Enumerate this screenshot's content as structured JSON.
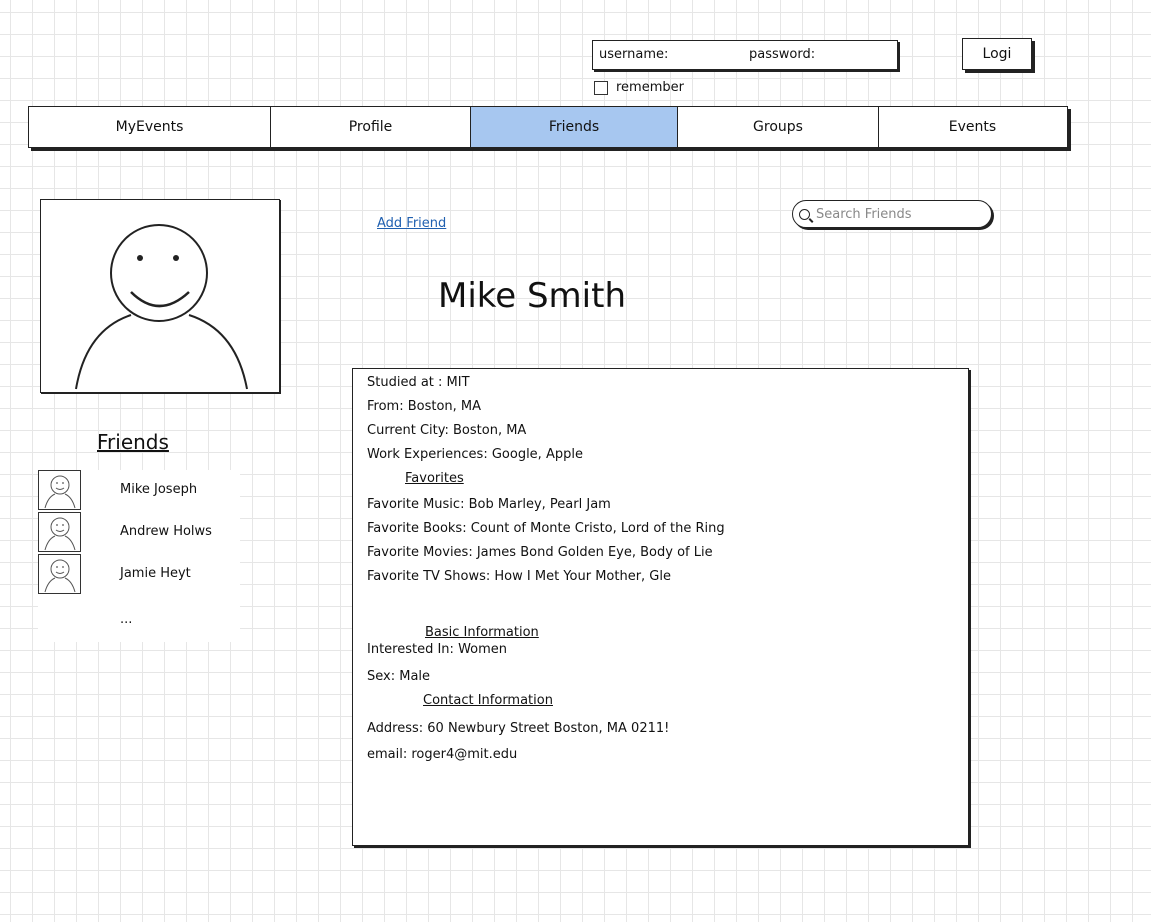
{
  "login": {
    "username_label": "username:",
    "password_label": "password:",
    "remember_label": "remember",
    "login_button": "Logi"
  },
  "nav": {
    "tabs": [
      {
        "label": "MyEvents"
      },
      {
        "label": "Profile"
      },
      {
        "label": "Friends",
        "active": true
      },
      {
        "label": "Groups"
      },
      {
        "label": "Events"
      }
    ],
    "active_color": "#a7c7f0"
  },
  "actions": {
    "add_friend": "Add Friend",
    "search_placeholder": "Search Friends"
  },
  "profile": {
    "name": "Mike Smith"
  },
  "friends": {
    "title": "Friends",
    "items": [
      {
        "name": "Mike Joseph"
      },
      {
        "name": "Andrew Holws"
      },
      {
        "name": "Jamie Heyt"
      }
    ],
    "more": "..."
  },
  "info": {
    "studied": "Studied at : MIT",
    "from": "From: Boston, MA",
    "current_city": "Current City: Boston, MA",
    "work": "Work Experiences: Google, Apple",
    "favorites_heading": "Favorites",
    "music": "Favorite Music: Bob Marley, Pearl Jam",
    "books": "Favorite Books: Count of Monte Cristo, Lord of the Ring",
    "movies": "Favorite Movies: James Bond Golden Eye, Body of Lie",
    "tv": "Favorite TV Shows: How I Met Your Mother, Gle",
    "basic_heading": "Basic Information",
    "interested": "Interested In: Women",
    "sex": "Sex: Male",
    "contact_heading": "Contact Information",
    "address": "Address: 60 Newbury Street Boston, MA 0211!",
    "email": "email: roger4@mit.edu"
  }
}
